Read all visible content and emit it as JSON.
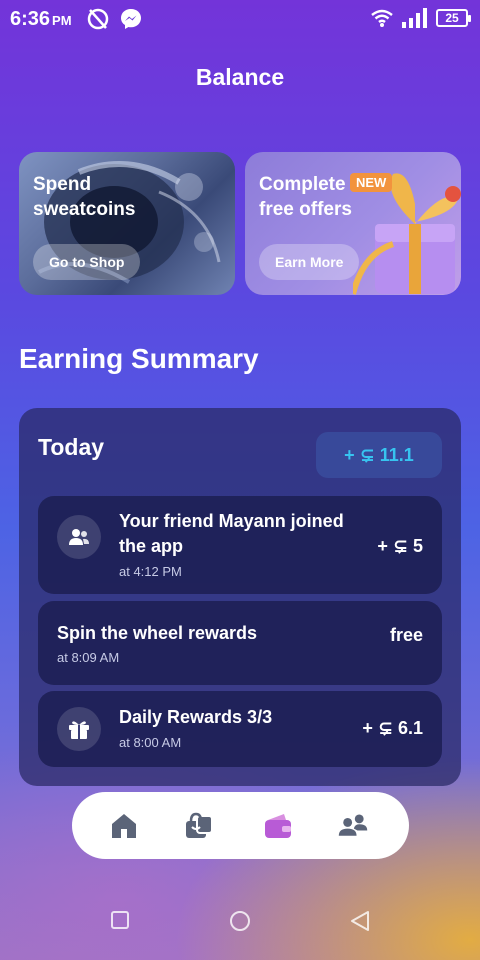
{
  "status_bar": {
    "time": "6:36",
    "ampm": "PM",
    "battery": "25"
  },
  "page_title": "Balance",
  "promos": {
    "shop": {
      "title": "Spend sweatcoins",
      "button": "Go to Shop"
    },
    "offers": {
      "title": "Complete free offers",
      "badge": "NEW",
      "button": "Earn More"
    }
  },
  "section_title": "Earning Summary",
  "summary": {
    "label": "Today",
    "total": "+ ⊊ 11.1",
    "rows": [
      {
        "title": "Your friend Mayann joined the app",
        "time": "at 4:12 PM",
        "amount": "+ ⊊ 5",
        "icon": "friends-icon"
      },
      {
        "title": "Spin the wheel rewards",
        "time": "at 8:09 AM",
        "amount": "free",
        "icon": ""
      },
      {
        "title": "Daily Rewards 3/3",
        "time": "at 8:00 AM",
        "amount": "+ ⊊ 6.1",
        "icon": "gift-icon"
      }
    ]
  },
  "bottom_nav": [
    "home-icon",
    "shop-bag-icon",
    "wallet-icon",
    "friends-icon"
  ],
  "colors": {
    "accent": "#37c4f0",
    "active_nav": "#b85bd6",
    "nav_icon": "#5b6478"
  }
}
